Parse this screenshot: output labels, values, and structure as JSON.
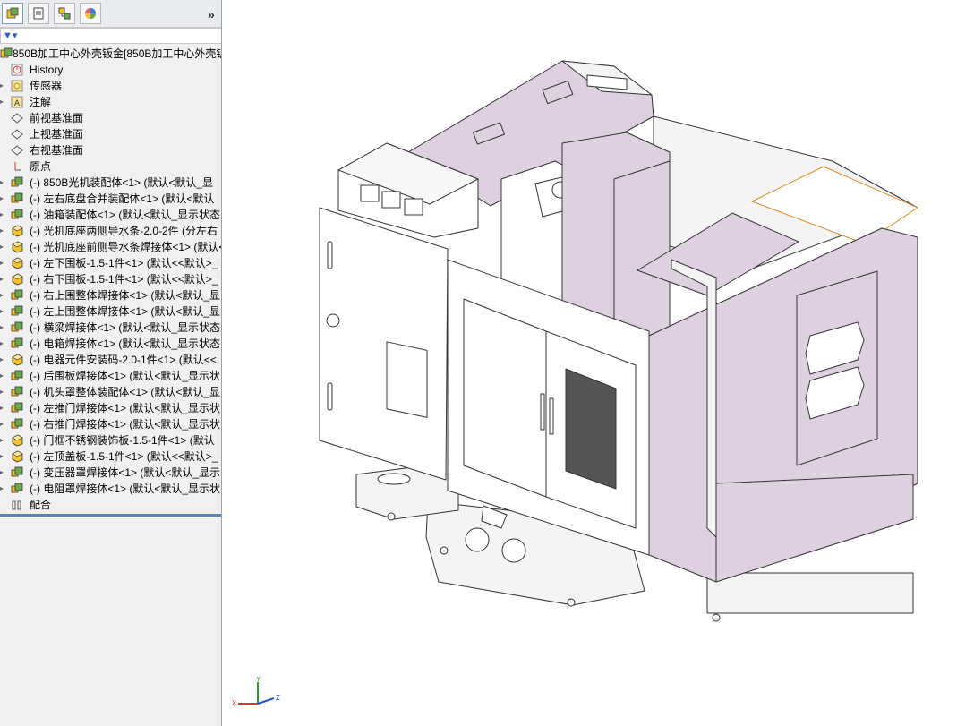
{
  "panel": {
    "tabs": [
      "feature-manager-tab",
      "property-manager-tab",
      "configuration-manager-tab",
      "display-manager-tab"
    ],
    "expand_glyph": "»"
  },
  "tree": {
    "root": "850B加工中心外壳钣金[850B加工中心外壳钣",
    "items": [
      {
        "label": "History",
        "icon": "history-icon"
      },
      {
        "label": "传感器",
        "icon": "sensor-icon"
      },
      {
        "label": "注解",
        "icon": "annotation-icon"
      },
      {
        "label": "前视基准面",
        "icon": "plane-icon"
      },
      {
        "label": "上视基准面",
        "icon": "plane-icon"
      },
      {
        "label": "右视基准面",
        "icon": "plane-icon"
      },
      {
        "label": "原点",
        "icon": "origin-icon"
      },
      {
        "label": "(-) 850B光机装配体<1> (默认<默认_显",
        "icon": "assembly-icon"
      },
      {
        "label": "(-) 左右底盘合并装配体<1> (默认<默认",
        "icon": "assembly-icon"
      },
      {
        "label": "(-) 油箱装配体<1> (默认<默认_显示状态",
        "icon": "assembly-icon"
      },
      {
        "label": "(-) 光机底座两侧导水条-2.0-2件 (分左右",
        "icon": "part-icon"
      },
      {
        "label": "(-) 光机底座前侧导水条焊接体<1> (默认<",
        "icon": "part-icon"
      },
      {
        "label": "(-) 左下围板-1.5-1件<1> (默认<<默认>_",
        "icon": "part-icon"
      },
      {
        "label": "(-) 右下围板-1.5-1件<1> (默认<<默认>_",
        "icon": "part-icon"
      },
      {
        "label": "(-) 右上围整体焊接体<1> (默认<默认_显",
        "icon": "assembly-icon"
      },
      {
        "label": "(-) 左上围整体焊接体<1> (默认<默认_显",
        "icon": "assembly-icon"
      },
      {
        "label": "(-) 横梁焊接体<1> (默认<默认_显示状态",
        "icon": "assembly-icon"
      },
      {
        "label": "(-) 电箱焊接体<1> (默认<默认_显示状态",
        "icon": "assembly-icon"
      },
      {
        "label": "(-) 电器元件安装码-2.0-1件<1> (默认<<",
        "icon": "part-icon"
      },
      {
        "label": "(-) 后围板焊接体<1> (默认<默认_显示状",
        "icon": "assembly-icon"
      },
      {
        "label": "(-) 机头罩整体装配体<1> (默认<默认_显",
        "icon": "assembly-icon"
      },
      {
        "label": "(-) 左推门焊接体<1> (默认<默认_显示状",
        "icon": "assembly-icon"
      },
      {
        "label": "(-) 右推门焊接体<1> (默认<默认_显示状",
        "icon": "assembly-icon"
      },
      {
        "label": "(-) 门框不锈钢装饰板-1.5-1件<1> (默认",
        "icon": "part-icon"
      },
      {
        "label": "(-) 左顶盖板-1.5-1件<1> (默认<<默认>_",
        "icon": "part-icon"
      },
      {
        "label": "(-) 变压器罩焊接体<1> (默认<默认_显示",
        "icon": "assembly-icon"
      },
      {
        "label": "(-) 电阻罩焊接体<1> (默认<默认_显示状",
        "icon": "assembly-icon"
      },
      {
        "label": "配合",
        "icon": "mates-icon"
      }
    ]
  },
  "triad": {
    "x": "X",
    "y": "Y",
    "z": "Z"
  },
  "colors": {
    "part_fill": "#ddd0df",
    "edge": "#333333",
    "highlight": "#e08a2a",
    "panel_bg": "#f0f0f0"
  }
}
